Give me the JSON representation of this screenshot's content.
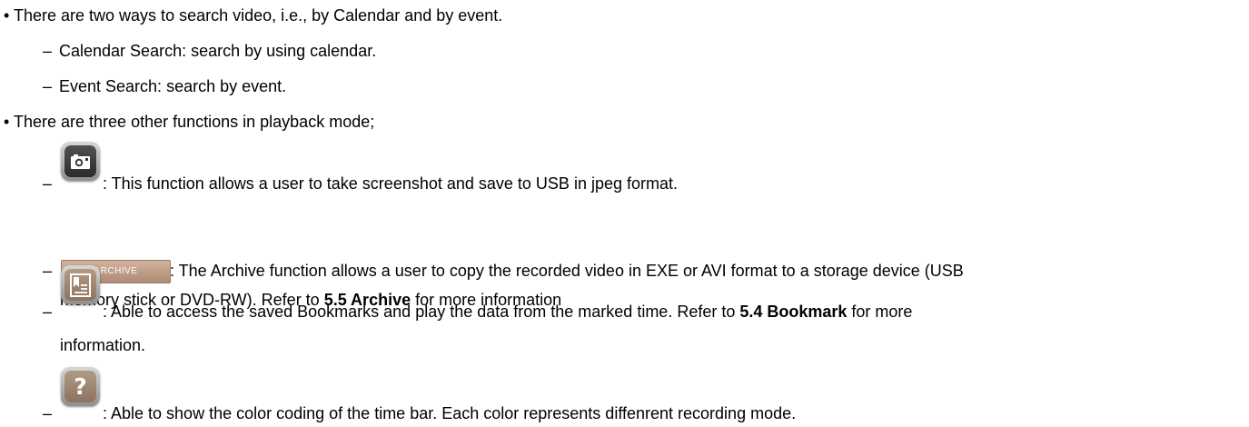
{
  "bullets": [
    "There are two ways to search video, i.e., by Calendar and by event.",
    "There are three other functions in playback mode;"
  ],
  "search_methods": [
    "Calendar Search: search by using calendar.",
    "Event Search: search by event."
  ],
  "functions": {
    "screenshot": {
      "icon": "camera-icon",
      "text": ": This function allows a user to take screenshot and save to USB in jpeg format."
    },
    "archive": {
      "button_label": "ARCHIVE",
      "text_line1": ": The Archive function allows a user to copy the recorded video in EXE or AVI format to a storage device (USB",
      "text_line2_pre": "memory stick or DVD-RW). Refer to ",
      "text_line2_bold": "5.5 Archive",
      "text_line2_post": " for more information"
    },
    "bookmark": {
      "icon": "bookmark-icon",
      "text_line1_pre": ": Able to access the saved Bookmarks and play the data from the marked time. Refer to ",
      "text_line1_bold": "5.4 Bookmark",
      "text_line1_post": " for more",
      "text_line2": "information."
    },
    "help": {
      "icon": "question-mark-icon",
      "glyph": "?",
      "text": ": Able to show the color coding of the time bar. Each color represents diffenrent recording mode."
    }
  },
  "dash": "–",
  "bullet_glyph": "•",
  "colors": {
    "camera_button": "#3c3c3c",
    "bookmark_button": "#a08470",
    "help_button": "#9e8673",
    "archive_button": "#c2a08a"
  }
}
